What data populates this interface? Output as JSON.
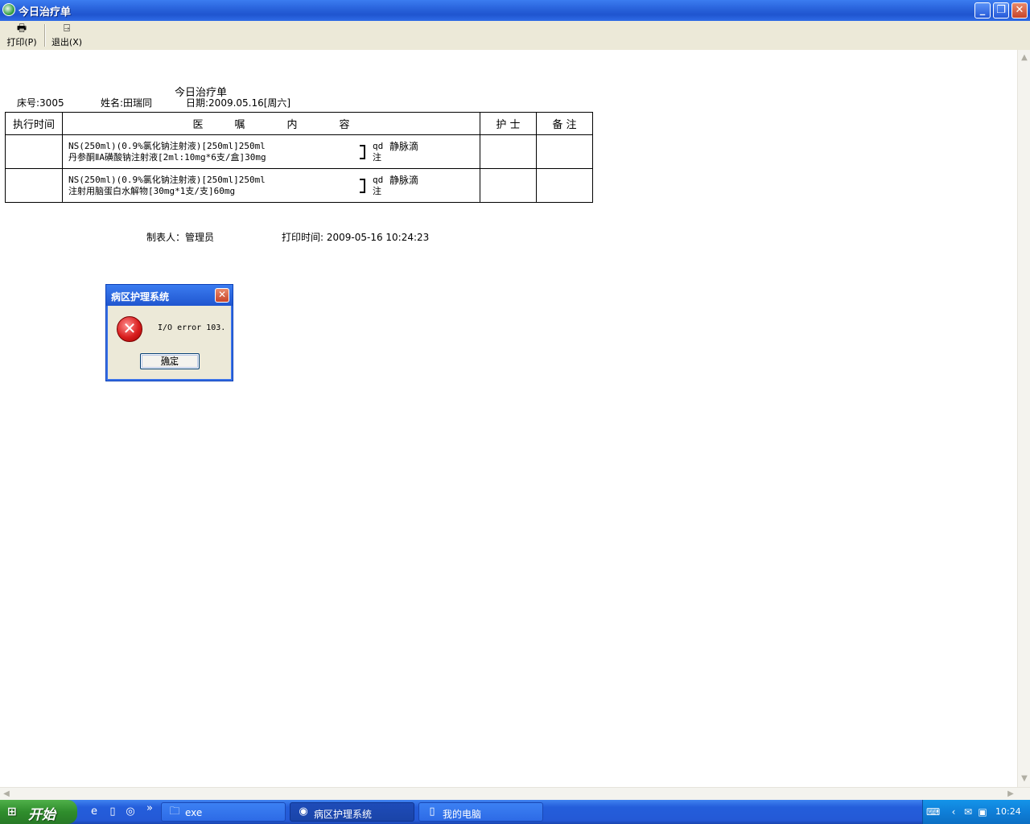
{
  "window": {
    "title": "今日治疗单",
    "minimize_glyph": "_",
    "restore_glyph": "❐",
    "close_glyph": "✕"
  },
  "toolbar": {
    "print_label": "打印(P)",
    "exit_label": "退出(X)"
  },
  "report": {
    "title": "今日治疗单",
    "bed_label": "床号:3005",
    "name_label": "姓名:田瑞同",
    "date_label": "日期:2009.05.16[周六]",
    "columns": {
      "time": "执行时间",
      "order": "医　　　嘱　　　　内　　　　容",
      "nurse": "护 士",
      "note": "备 注"
    },
    "rows": [
      {
        "line1": "NS(250ml)(0.9%氯化钠注射液)[250ml]250ml",
        "line2": "丹参酮ⅡA磺酸钠注射液[2ml:10mg*6支/盒]30mg",
        "freq1": "qd",
        "freq2": "注",
        "route": "静脉滴"
      },
      {
        "line1": "NS(250ml)(0.9%氯化钠注射液)[250ml]250ml",
        "line2": "注射用脑蛋白水解物[30mg*1支/支]60mg",
        "freq1": "qd",
        "freq2": "注",
        "route": "静脉滴"
      }
    ],
    "maker": "制表人：管理员",
    "print_time": "打印时间: 2009-05-16   10:24:23"
  },
  "dialog": {
    "title": "病区护理系统",
    "message": "I/O error 103.",
    "ok_label": "确定"
  },
  "taskbar": {
    "start_label": "开始",
    "tasks": [
      {
        "label": "exe"
      },
      {
        "label": "病区护理系统"
      },
      {
        "label": "我的电脑"
      }
    ],
    "clock": "10:24"
  }
}
